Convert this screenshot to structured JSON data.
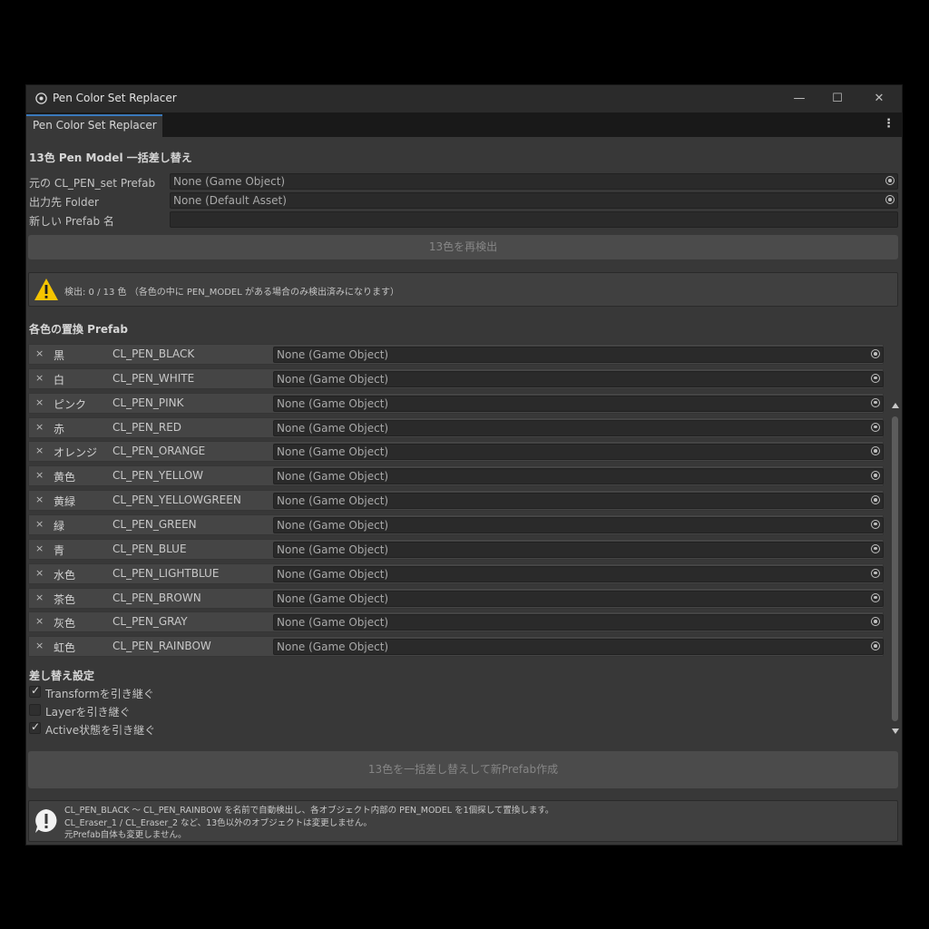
{
  "window": {
    "title": "Pen Color Set Replacer",
    "tab_label": "Pen Color Set Replacer",
    "minimize": "—",
    "maximize": "☐",
    "close": "✕",
    "menu": "⋮"
  },
  "header": "13色 Pen Model 一括差し替え",
  "fields": [
    {
      "label": "元の CL_PEN_set Prefab",
      "value": "None (Game Object)"
    },
    {
      "label": "出力先 Folder",
      "value": "None (Default Asset)"
    },
    {
      "label": "新しい Prefab 名",
      "value": ""
    }
  ],
  "redetect_button": "13色を再検出",
  "detect_status": "検出: 0 / 13 色 （各色の中に PEN_MODEL がある場合のみ検出済みになります）",
  "replace_section": "各色の置換 Prefab",
  "clear_glyph": "×",
  "rows": [
    {
      "jp": "黒",
      "id": "CL_PEN_BLACK",
      "value": "None (Game Object)"
    },
    {
      "jp": "白",
      "id": "CL_PEN_WHITE",
      "value": "None (Game Object)"
    },
    {
      "jp": "ピンク",
      "id": "CL_PEN_PINK",
      "value": "None (Game Object)"
    },
    {
      "jp": "赤",
      "id": "CL_PEN_RED",
      "value": "None (Game Object)"
    },
    {
      "jp": "オレンジ",
      "id": "CL_PEN_ORANGE",
      "value": "None (Game Object)"
    },
    {
      "jp": "黄色",
      "id": "CL_PEN_YELLOW",
      "value": "None (Game Object)"
    },
    {
      "jp": "黄緑",
      "id": "CL_PEN_YELLOWGREEN",
      "value": "None (Game Object)"
    },
    {
      "jp": "緑",
      "id": "CL_PEN_GREEN",
      "value": "None (Game Object)"
    },
    {
      "jp": "青",
      "id": "CL_PEN_BLUE",
      "value": "None (Game Object)"
    },
    {
      "jp": "水色",
      "id": "CL_PEN_LIGHTBLUE",
      "value": "None (Game Object)"
    },
    {
      "jp": "茶色",
      "id": "CL_PEN_BROWN",
      "value": "None (Game Object)"
    },
    {
      "jp": "灰色",
      "id": "CL_PEN_GRAY",
      "value": "None (Game Object)"
    },
    {
      "jp": "虹色",
      "id": "CL_PEN_RAINBOW",
      "value": "None (Game Object)"
    }
  ],
  "settings": {
    "title": "差し替え設定",
    "options": [
      {
        "label": "Transformを引き継ぐ",
        "checked": true
      },
      {
        "label": "Layerを引き継ぐ",
        "checked": false
      },
      {
        "label": "Active状態を引き継ぐ",
        "checked": true
      }
    ]
  },
  "replace_button": "13色を一括差し替えして新Prefab作成",
  "info_lines": [
    "CL_PEN_BLACK 〜 CL_PEN_RAINBOW を名前で自動検出し、各オブジェクト内部の PEN_MODEL を1個探して置換します。",
    "CL_Eraser_1 / CL_Eraser_2 など、13色以外のオブジェクトは変更しません。",
    "元Prefab自体も変更しません。"
  ],
  "colors": {
    "accent": "#3a79bb",
    "warning": "#f5c400",
    "window_bg": "#383838"
  }
}
